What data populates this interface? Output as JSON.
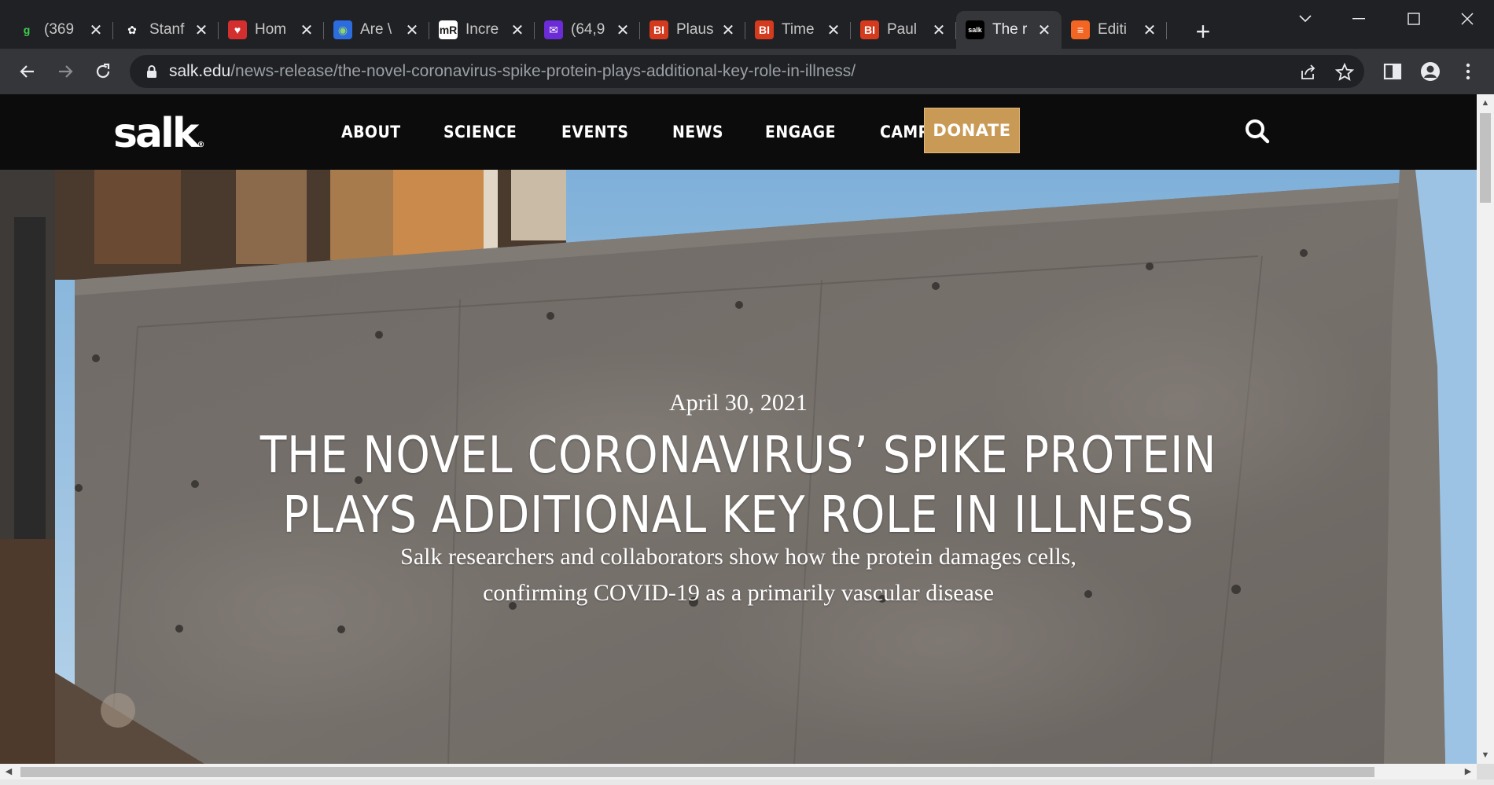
{
  "browser": {
    "tabs": [
      {
        "title": "(369",
        "favicon": "g",
        "fav_bg": "#202124",
        "fav_color": "#3ccf4e"
      },
      {
        "title": "Stanf",
        "favicon": "✿",
        "fav_bg": "#202124",
        "fav_color": "#ffffff"
      },
      {
        "title": "Hom",
        "favicon": "♥",
        "fav_bg": "#d32f2f",
        "fav_color": "#ffffff"
      },
      {
        "title": "Are \\",
        "favicon": "◉",
        "fav_bg": "#2d6cdf",
        "fav_color": "#8fd36b"
      },
      {
        "title": "Incre",
        "favicon": "mR",
        "fav_bg": "#ffffff",
        "fav_color": "#1a1a1a"
      },
      {
        "title": "(64,9",
        "favicon": "✉",
        "fav_bg": "#6b2bd6",
        "fav_color": "#ffffff"
      },
      {
        "title": "Plaus",
        "favicon": "BI",
        "fav_bg": "#d43a1e",
        "fav_color": "#ffffff"
      },
      {
        "title": "Time",
        "favicon": "BI",
        "fav_bg": "#d43a1e",
        "fav_color": "#ffffff"
      },
      {
        "title": "Paul",
        "favicon": "BI",
        "fav_bg": "#d43a1e",
        "fav_color": "#ffffff"
      },
      {
        "title": "The r",
        "favicon": "salk",
        "fav_bg": "#000000",
        "fav_color": "#ffffff",
        "active": true
      },
      {
        "title": "Editi",
        "favicon": "≡",
        "fav_bg": "#f26522",
        "fav_color": "#ffffff"
      }
    ],
    "new_tab_label": "+",
    "url_host": "salk.edu",
    "url_path": "/news-release/the-novel-coronavirus-spike-protein-plays-additional-key-role-in-illness/"
  },
  "site": {
    "logo": "salk",
    "logo_mark": "®",
    "nav": [
      "ABOUT",
      "SCIENCE",
      "EVENTS",
      "NEWS",
      "ENGAGE",
      "CAMPAIGN"
    ],
    "donate": "DONATE",
    "accent": "#c99a55"
  },
  "article": {
    "date": "April 30, 2021",
    "title": "THE NOVEL CORONAVIRUS’ SPIKE PROTEIN PLAYS ADDITIONAL KEY ROLE IN ILLNESS",
    "subtitle": "Salk researchers and collaborators show how the protein damages cells, confirming COVID-19 as a primarily vascular disease"
  }
}
